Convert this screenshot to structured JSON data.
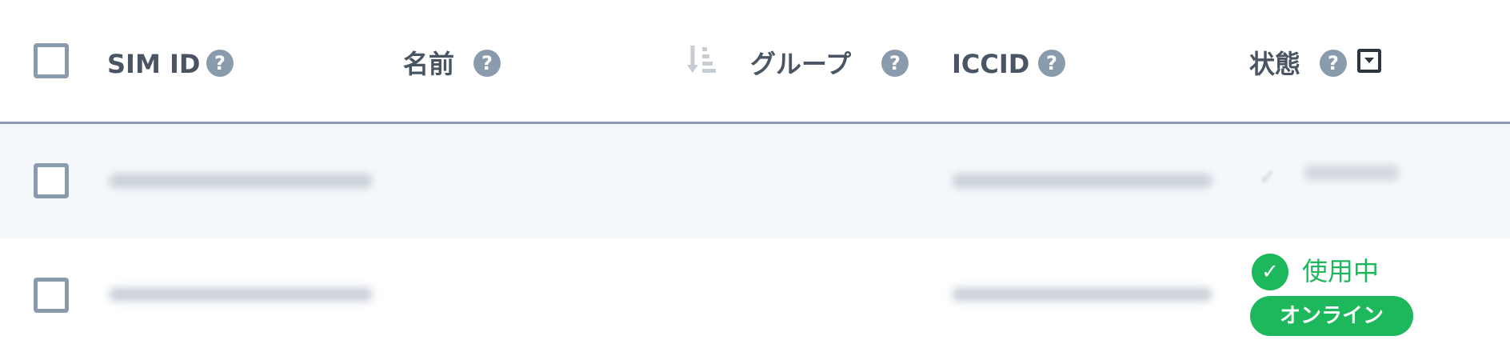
{
  "columns": {
    "sim_id": "SIM ID",
    "name": "名前",
    "group": "グループ",
    "iccid": "ICCID",
    "status": "状態"
  },
  "help_glyph": "?",
  "rows": [
    {
      "status_label": ""
    },
    {
      "status_label": "使用中",
      "online_badge": "オンライン"
    }
  ],
  "colors": {
    "accent_green": "#1cb85b",
    "header_border": "#8a9bad",
    "label_text": "#4a5563",
    "row_highlight": "#f5f8fb"
  },
  "icons": [
    "checkbox",
    "help-icon",
    "sort-desc-icon",
    "filter-icon",
    "check-circle-icon"
  ]
}
